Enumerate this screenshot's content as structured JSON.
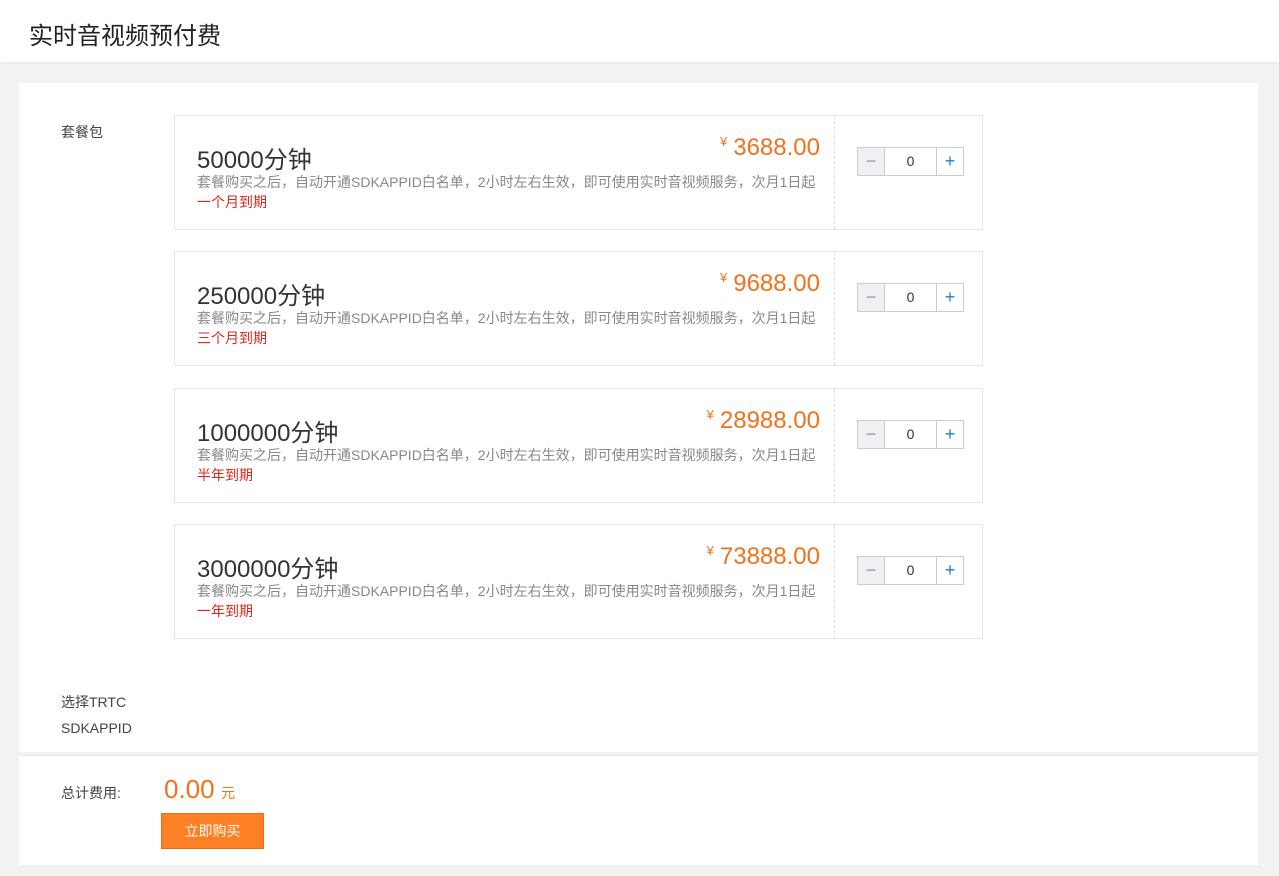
{
  "header": {
    "title": "实时音视频预付费"
  },
  "labels": {
    "package": "套餐包",
    "app_line1": "选择TRTC",
    "app_line2": "SDKAPPID"
  },
  "packages": [
    {
      "name": "50000分钟",
      "currency": "¥",
      "price": "3688.00",
      "desc": "套餐购买之后，自动开通SDKAPPID白名单，2小时左右生效，即可使用实时音视频服务，次月1日起",
      "duration": "一个月到期",
      "quantity": "0"
    },
    {
      "name": "250000分钟",
      "currency": "¥",
      "price": "9688.00",
      "desc": "套餐购买之后，自动开通SDKAPPID白名单，2小时左右生效，即可使用实时音视频服务，次月1日起",
      "duration": "三个月到期",
      "quantity": "0"
    },
    {
      "name": "1000000分钟",
      "currency": "¥",
      "price": "28988.00",
      "desc": "套餐购买之后，自动开通SDKAPPID白名单，2小时左右生效，即可使用实时音视频服务，次月1日起",
      "duration": "半年到期",
      "quantity": "0"
    },
    {
      "name": "3000000分钟",
      "currency": "¥",
      "price": "73888.00",
      "desc": "套餐购买之后，自动开通SDKAPPID白名单，2小时左右生效，即可使用实时音视频服务，次月1日起",
      "duration": "一年到期",
      "quantity": "0"
    }
  ],
  "stepper": {
    "minus": "−",
    "plus": "+"
  },
  "footer": {
    "total_label": "总计费用:",
    "total_amount": "0.00",
    "total_unit": "元",
    "buy_label": "立即购买"
  },
  "colors": {
    "accent": "#f2711c",
    "button": "#ff7f24",
    "duration": "#e1241b",
    "stepper_plus": "#1b7fd1"
  }
}
